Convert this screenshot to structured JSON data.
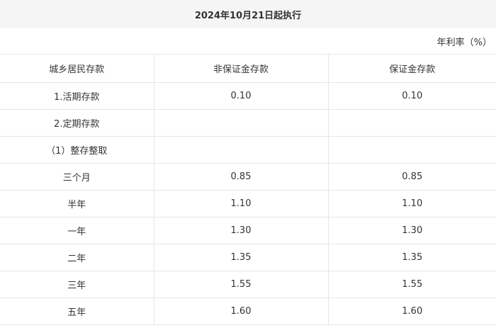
{
  "title": "2024年10月21日起执行",
  "unit_label": "年利率（%）",
  "columns": [
    "城乡居民存款",
    "非保证金存款",
    "保证金存款"
  ],
  "rows": [
    [
      "1.活期存款",
      "0.10",
      "0.10"
    ],
    [
      "2.定期存款",
      "",
      ""
    ],
    [
      "（1）整存整取",
      "",
      ""
    ],
    [
      "三个月",
      "0.85",
      "0.85"
    ],
    [
      "半年",
      "1.10",
      "1.10"
    ],
    [
      "一年",
      "1.30",
      "1.30"
    ],
    [
      "二年",
      "1.35",
      "1.35"
    ],
    [
      "三年",
      "1.55",
      "1.55"
    ],
    [
      "五年",
      "1.60",
      "1.60"
    ]
  ]
}
